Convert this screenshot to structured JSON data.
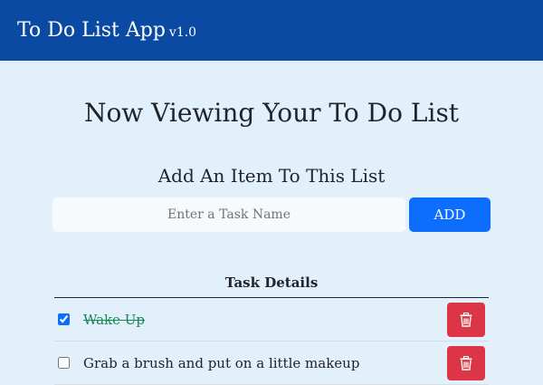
{
  "navbar": {
    "title": "To Do List App",
    "version": "v1.0"
  },
  "main": {
    "heading": "Now Viewing Your To Do List",
    "add_heading": "Add An Item To This List",
    "input_placeholder": "Enter a Task Name",
    "input_value": "",
    "add_label": "ADD"
  },
  "table": {
    "header": "Task Details",
    "tasks": [
      {
        "name": "Wake Up",
        "done": true
      },
      {
        "name": "Grab a brush and put on a little makeup",
        "done": false
      }
    ]
  },
  "colors": {
    "navbar": "#0b4aa2",
    "background": "#e1f0fb",
    "primary": "#0d6efd",
    "danger": "#dc3545",
    "done_text": "#198754"
  },
  "icons": {
    "delete": "trash-icon"
  }
}
